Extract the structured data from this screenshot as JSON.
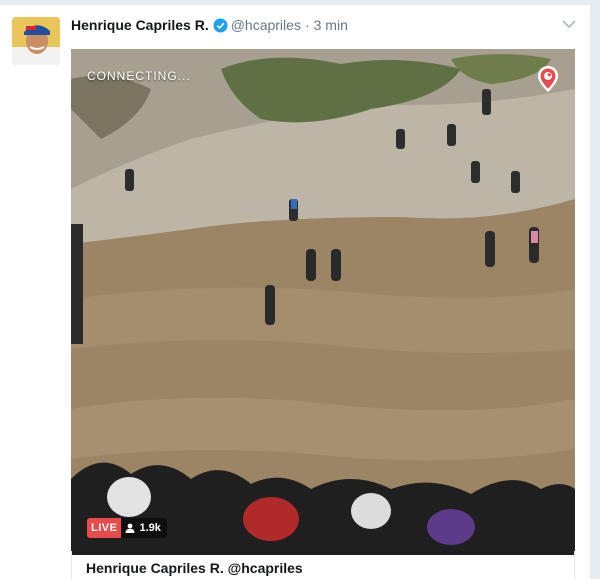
{
  "tweet": {
    "display_name": "Henrique Capriles R.",
    "handle": "@hcapriles",
    "separator": "·",
    "time": "3 min",
    "verified_icon": "verified-badge-icon",
    "menu_icon": "chevron-down-icon"
  },
  "media": {
    "status_text": "CONNECTING...",
    "live_label": "LIVE",
    "viewer_count": "1.9k",
    "viewer_icon": "person-icon",
    "brand_icon": "periscope-icon"
  },
  "card": {
    "title": "Henrique Capriles R. @hcapriles"
  },
  "colors": {
    "verified": "#1da1f2",
    "live": "#e84b4b",
    "periscope": "#e84b4b",
    "water": "#9c8565",
    "background": "#e6ecf0"
  }
}
